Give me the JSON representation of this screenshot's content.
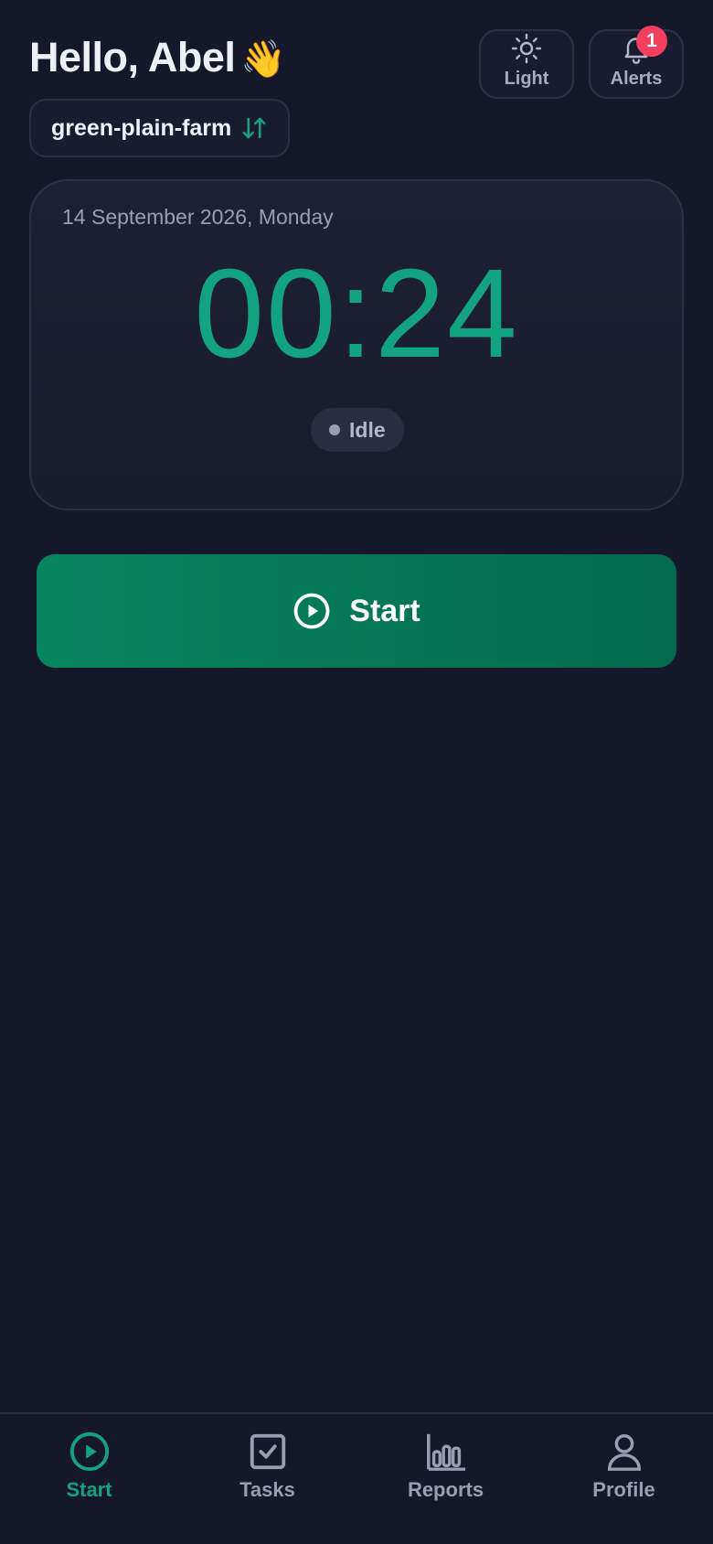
{
  "header": {
    "greeting": "Hello, Abel",
    "wave_emoji": "👋",
    "light_label": "Light",
    "alerts_label": "Alerts",
    "alerts_count": "1"
  },
  "farm": {
    "name": "green-plain-farm",
    "switch_icon": "swap-vertical-icon"
  },
  "timer": {
    "date": "14 September 2026, Monday",
    "time": "00:24",
    "status": "Idle"
  },
  "start_button": {
    "label": "Start"
  },
  "nav": {
    "items": [
      {
        "label": "Start",
        "icon": "play-circle-icon",
        "active": true
      },
      {
        "label": "Tasks",
        "icon": "checkbox-icon",
        "active": false
      },
      {
        "label": "Reports",
        "icon": "bar-chart-icon",
        "active": false
      },
      {
        "label": "Profile",
        "icon": "user-icon",
        "active": false
      }
    ]
  },
  "colors": {
    "background": "#15172a",
    "accent": "#14a37f",
    "badge": "#f43f5e",
    "start_button": "#06855f"
  }
}
